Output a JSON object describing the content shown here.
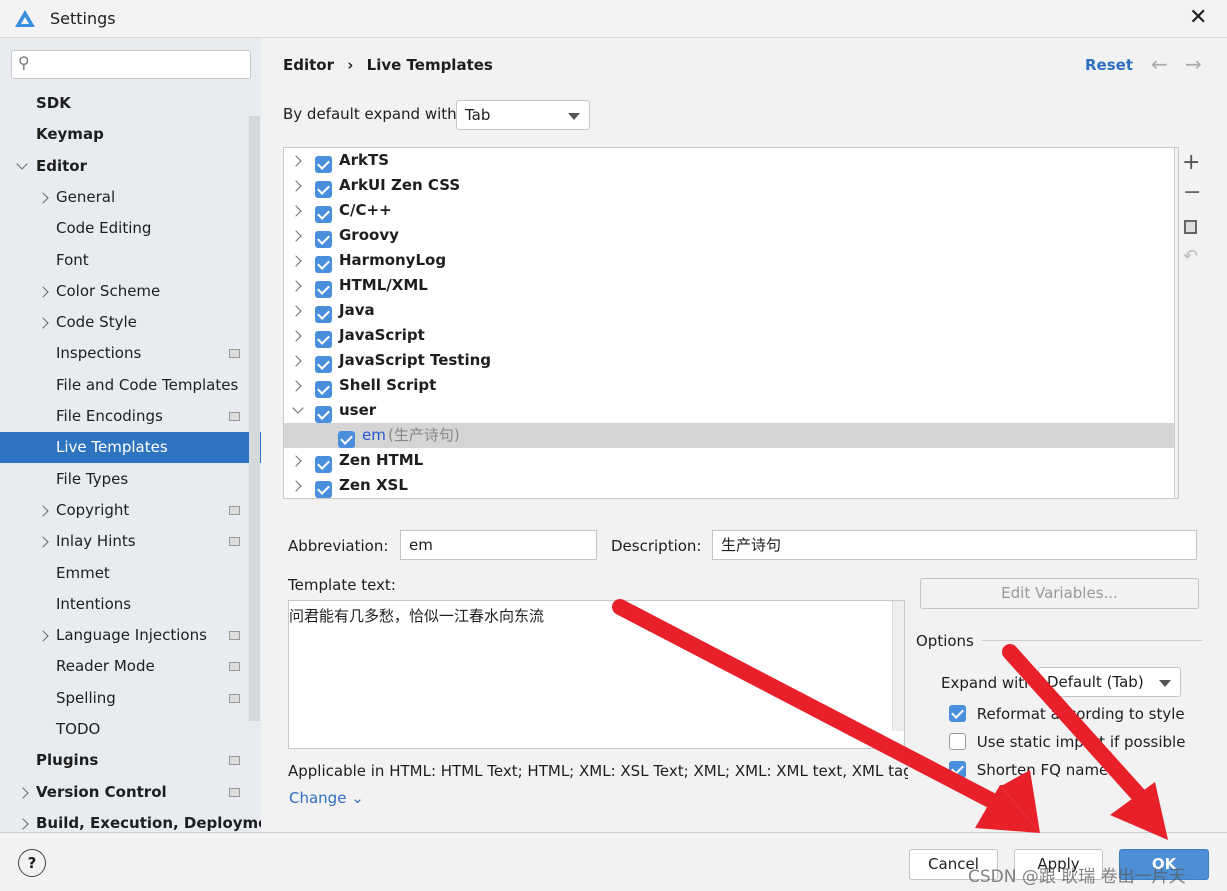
{
  "window": {
    "title": "Settings",
    "close_icon": "close-icon"
  },
  "sidebar": {
    "search_placeholder": "",
    "items": [
      {
        "label": "SDK",
        "level": 0,
        "bold": true
      },
      {
        "label": "Keymap",
        "level": 0,
        "bold": true
      },
      {
        "label": "Editor",
        "level": 0,
        "bold": true,
        "expanded": true
      },
      {
        "label": "General",
        "level": 1,
        "chevron": true
      },
      {
        "label": "Code Editing",
        "level": 1
      },
      {
        "label": "Font",
        "level": 1
      },
      {
        "label": "Color Scheme",
        "level": 1,
        "chevron": true
      },
      {
        "label": "Code Style",
        "level": 1,
        "chevron": true
      },
      {
        "label": "Inspections",
        "level": 1,
        "project_icon": true
      },
      {
        "label": "File and Code Templates",
        "level": 1
      },
      {
        "label": "File Encodings",
        "level": 1,
        "project_icon": true
      },
      {
        "label": "Live Templates",
        "level": 1,
        "selected": true
      },
      {
        "label": "File Types",
        "level": 1
      },
      {
        "label": "Copyright",
        "level": 1,
        "chevron": true,
        "project_icon": true
      },
      {
        "label": "Inlay Hints",
        "level": 1,
        "chevron": true,
        "project_icon": true
      },
      {
        "label": "Emmet",
        "level": 1
      },
      {
        "label": "Intentions",
        "level": 1
      },
      {
        "label": "Language Injections",
        "level": 1,
        "chevron": true,
        "project_icon": true
      },
      {
        "label": "Reader Mode",
        "level": 1,
        "project_icon": true
      },
      {
        "label": "Spelling",
        "level": 1,
        "project_icon": true
      },
      {
        "label": "TODO",
        "level": 1
      },
      {
        "label": "Plugins",
        "level": 0,
        "bold": true,
        "project_icon": true
      },
      {
        "label": "Version Control",
        "level": 0,
        "bold": true,
        "chevron": true,
        "project_icon": true
      },
      {
        "label": "Build, Execution, Deployment",
        "level": 0,
        "bold": true,
        "chevron": true
      }
    ]
  },
  "header": {
    "breadcrumb": [
      "Editor",
      "Live Templates"
    ],
    "reset": "Reset"
  },
  "expand": {
    "label": "By default expand with",
    "value": "Tab"
  },
  "templates": [
    {
      "label": "ArkTS",
      "checked": true
    },
    {
      "label": "ArkUI Zen CSS",
      "checked": true
    },
    {
      "label": "C/C++",
      "checked": true
    },
    {
      "label": "Groovy",
      "checked": true
    },
    {
      "label": "HarmonyLog",
      "checked": true
    },
    {
      "label": "HTML/XML",
      "checked": true
    },
    {
      "label": "Java",
      "checked": true
    },
    {
      "label": "JavaScript",
      "checked": true
    },
    {
      "label": "JavaScript Testing",
      "checked": true
    },
    {
      "label": "Shell Script",
      "checked": true
    },
    {
      "label": "user",
      "checked": true,
      "expanded": true
    },
    {
      "label": "em",
      "desc": "(生产诗句)",
      "checked": true,
      "child": true,
      "selected": true
    },
    {
      "label": "Zen HTML",
      "checked": true
    },
    {
      "label": "Zen XSL",
      "checked": true
    }
  ],
  "editor": {
    "abbreviation_label": "Abbreviation:",
    "abbreviation": "em",
    "description_label": "Description:",
    "description": "生产诗句",
    "template_text_label": "Template text:",
    "template_text": "问君能有几多愁，恰似一江春水向东流",
    "edit_variables": "Edit Variables...",
    "applicable": "Applicable in HTML: HTML Text; HTML; XML: XSL Text; XML; XML: XML text, XML tag",
    "change": "Change"
  },
  "options": {
    "title": "Options",
    "expand_label": "Expand with",
    "expand_value": "Default (Tab)",
    "checks": [
      {
        "label": "Reformat according to style",
        "checked": true
      },
      {
        "label": "Use static import if possible",
        "checked": false
      },
      {
        "label": "Shorten FQ names",
        "checked": true
      }
    ]
  },
  "footer": {
    "help": "?",
    "cancel": "Cancel",
    "apply": "Apply",
    "ok": "OK",
    "watermark": "CSDN @跟 耿瑞 卷出一片天"
  },
  "colors": {
    "accent": "#2f74c0",
    "link": "#2f6fc0",
    "arrow": "#e8202a"
  }
}
